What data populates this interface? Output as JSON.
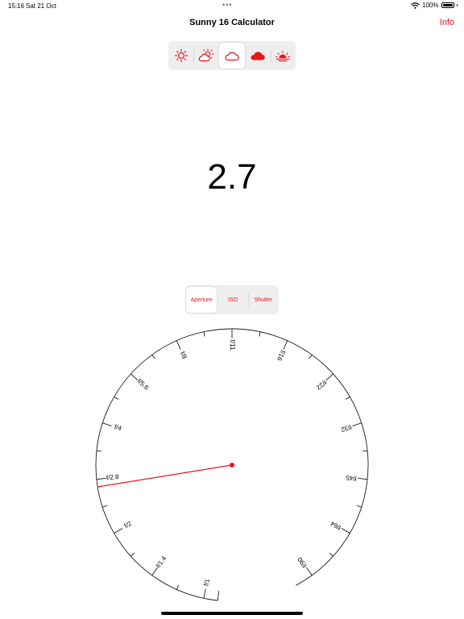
{
  "status": {
    "time": "15:16",
    "date": "Sat 21 Oct",
    "dots": "•••",
    "battery_text": "100%",
    "battery_level": 1.0,
    "icons": [
      "wifi-icon",
      "battery-icon"
    ]
  },
  "nav": {
    "title": "Sunny 16 Calculator",
    "info_label": "Info"
  },
  "accent_color": "#e8141a",
  "weather": {
    "selected_index": 2,
    "options": [
      "sun-icon",
      "partly-cloudy-icon",
      "cloud-outline-icon",
      "cloud-filled-icon",
      "sunset-icon"
    ]
  },
  "result": {
    "value": "2.7"
  },
  "modes": {
    "selected_index": 0,
    "items": [
      "Aperture",
      "ISO",
      "Shutter"
    ]
  },
  "dial": {
    "labels": [
      "f/1",
      "f/1.4",
      "f/2",
      "f/2.8",
      "f/4",
      "f/5.6",
      "f/8",
      "f/11",
      "f/16",
      "f/22",
      "f/32",
      "f/45",
      "f/64",
      "f/90"
    ],
    "needle_value": "2.7"
  }
}
